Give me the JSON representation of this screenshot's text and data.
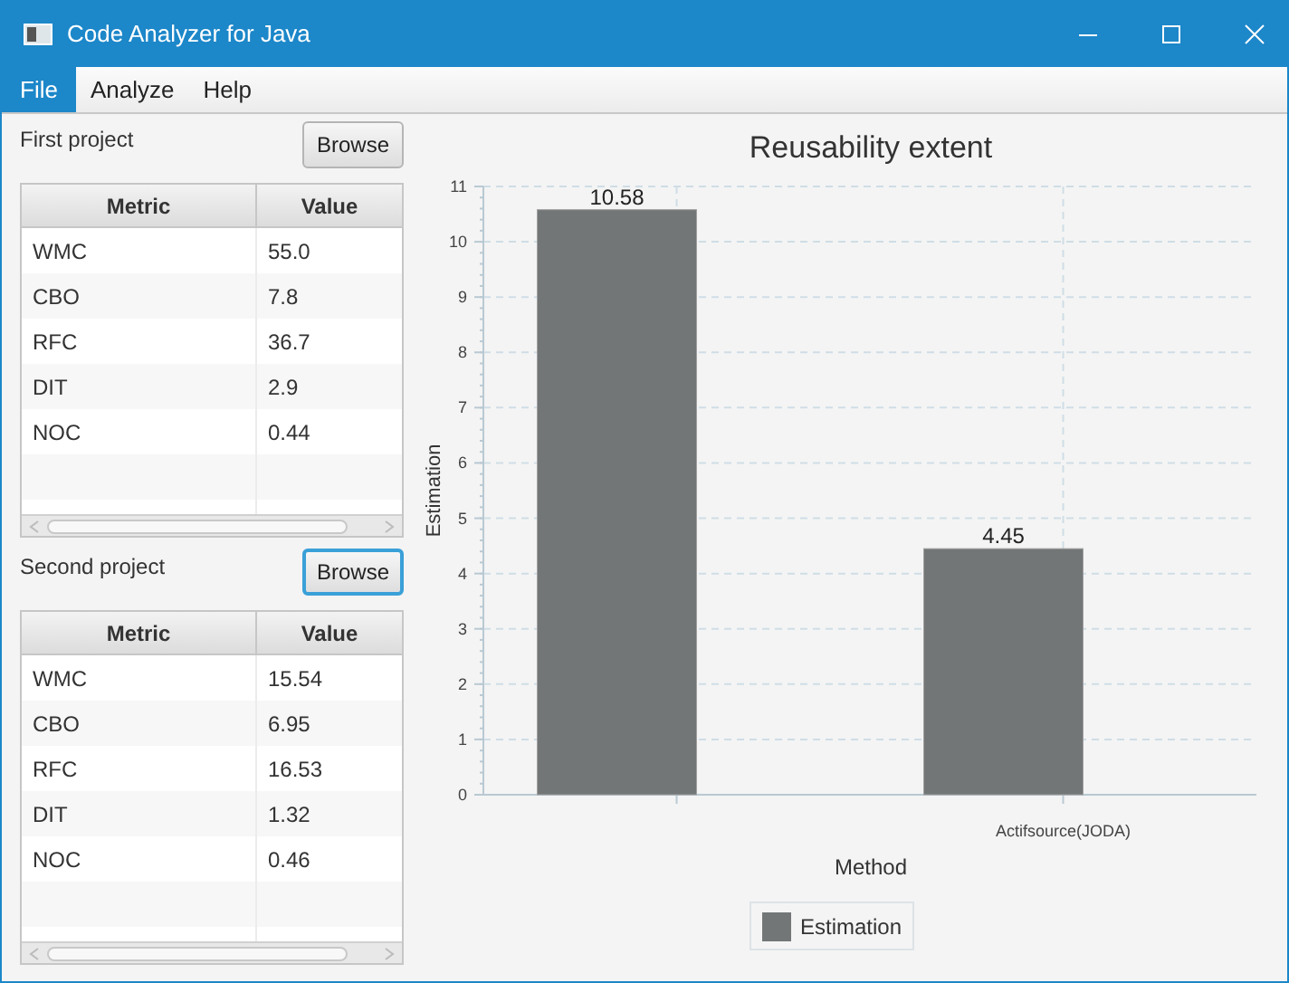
{
  "window": {
    "title": "Code Analyzer for Java"
  },
  "menu": [
    {
      "label": "File",
      "selected": true
    },
    {
      "label": "Analyze",
      "selected": false
    },
    {
      "label": "Help",
      "selected": false
    }
  ],
  "projects": [
    {
      "label": "First project",
      "button": {
        "label": "Browse",
        "focused": false
      },
      "columns": [
        "Metric",
        "Value"
      ],
      "rows": [
        [
          "WMC",
          "55.0"
        ],
        [
          "CBO",
          "7.8"
        ],
        [
          "RFC",
          "36.7"
        ],
        [
          "DIT",
          "2.9"
        ],
        [
          "NOC",
          "0.44"
        ]
      ]
    },
    {
      "label": "Second project",
      "button": {
        "label": "Browse",
        "focused": true
      },
      "columns": [
        "Metric",
        "Value"
      ],
      "rows": [
        [
          "WMC",
          "15.54"
        ],
        [
          "CBO",
          "6.95"
        ],
        [
          "RFC",
          "16.53"
        ],
        [
          "DIT",
          "1.32"
        ],
        [
          "NOC",
          "0.46"
        ]
      ]
    }
  ],
  "chart": {
    "chart_data": {
      "type": "bar",
      "title": "Reusability extent",
      "xlabel": "Method",
      "ylabel": "Estimation",
      "categories": [
        null,
        "Actifsource(JODA)"
      ],
      "series": [
        {
          "name": "Estimation",
          "color": "#737677",
          "values": [
            10.58,
            4.45
          ]
        }
      ],
      "ylim": [
        0,
        11
      ],
      "yticks": [
        0,
        1,
        2,
        3,
        4,
        5,
        6,
        7,
        8,
        9,
        10,
        11
      ],
      "data_labels": true,
      "grid": true
    }
  }
}
